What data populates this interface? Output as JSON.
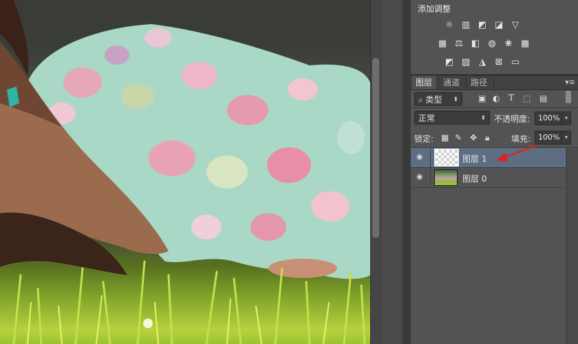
{
  "canvas": {
    "description_icon": "photo-canvas"
  },
  "adjustments": {
    "title": "添加调整",
    "row1_icons": [
      "brightness-icon",
      "levels-icon",
      "curves-icon",
      "exposure-icon",
      "vibrance-icon"
    ],
    "row2_icons": [
      "hue-saturation-icon",
      "color-balance-icon",
      "black-white-icon",
      "photo-filter-icon",
      "channel-mixer-icon",
      "color-lookup-icon"
    ],
    "row3_icons": [
      "invert-icon",
      "posterize-icon",
      "threshold-icon",
      "selective-color-icon",
      "gradient-map-icon"
    ]
  },
  "layers_panel": {
    "tabs": [
      {
        "label": "图层",
        "active": true
      },
      {
        "label": "通道",
        "active": false
      },
      {
        "label": "路径",
        "active": false
      }
    ],
    "filter": {
      "label": "类型",
      "icons": [
        "image-filter-icon",
        "adjustment-filter-icon",
        "type-filter-icon",
        "shape-filter-icon",
        "smart-object-filter-icon"
      ]
    },
    "blend_mode": "正常",
    "opacity_label": "不透明度:",
    "opacity_value": "100%",
    "lock_label": "锁定:",
    "lock_icons": [
      "lock-transparent-icon",
      "lock-image-icon",
      "lock-position-icon",
      "lock-all-icon"
    ],
    "fill_label": "填充:",
    "fill_value": "100%",
    "layers": [
      {
        "name": "图层 1",
        "selected": true,
        "thumbnail": "transparent"
      },
      {
        "name": "图层 0",
        "selected": false,
        "thumbnail": "photo"
      }
    ]
  },
  "colors": {
    "selection": "#5d6d82",
    "annotation_arrow": "#e02020"
  }
}
